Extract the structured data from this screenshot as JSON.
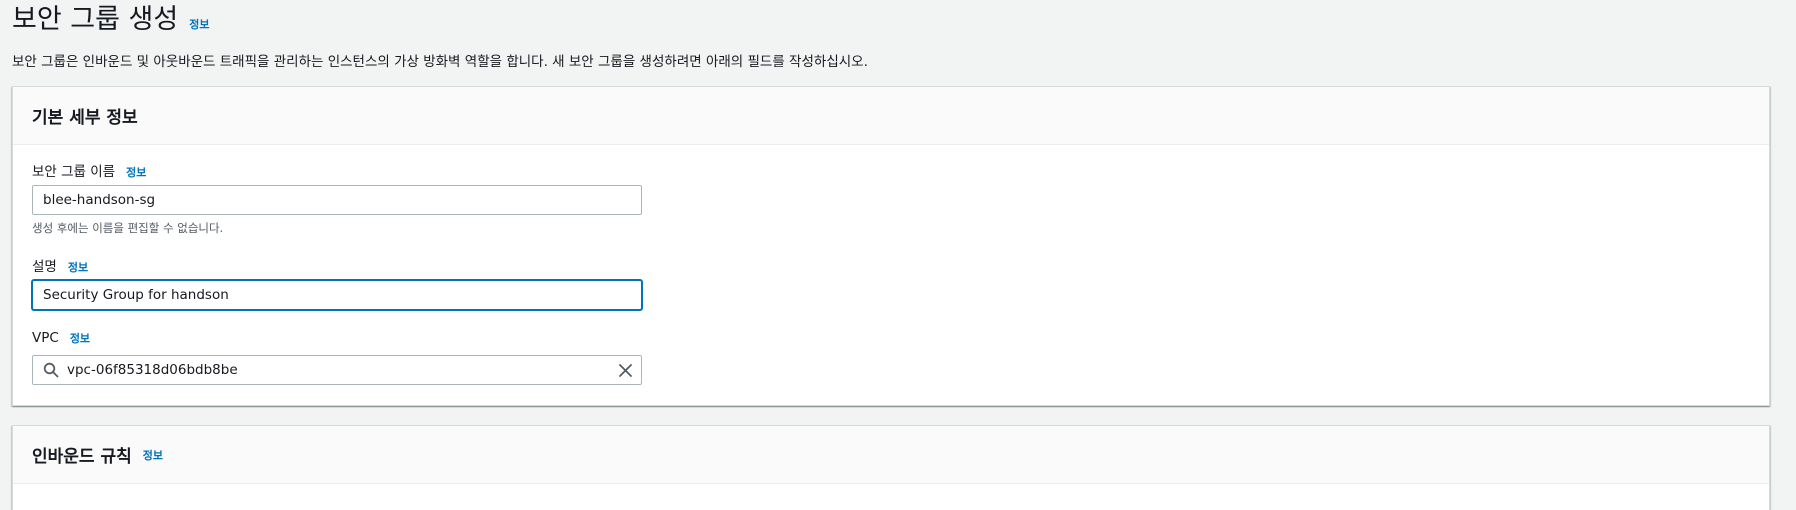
{
  "header": {
    "title": "보안 그룹 생성",
    "info_label": "정보",
    "description": "보안 그룹은 인바운드 및 아웃바운드 트래픽을 관리하는 인스턴스의 가상 방화벽 역할을 합니다. 새 보안 그룹을 생성하려면 아래의 필드를 작성하십시오."
  },
  "basic_details": {
    "title": "기본 세부 정보",
    "name_field": {
      "label": "보안 그룹 이름",
      "info_label": "정보",
      "value": "blee-handson-sg",
      "hint": "생성 후에는 이름을 편집할 수 없습니다."
    },
    "description_field": {
      "label": "설명",
      "info_label": "정보",
      "value": "Security Group for handson"
    },
    "vpc_field": {
      "label": "VPC",
      "info_label": "정보",
      "value": "vpc-06f85318d06bdb8be"
    }
  },
  "inbound_rules": {
    "title": "인바운드 규칙",
    "info_label": "정보"
  },
  "colors": {
    "link": "#0073bb",
    "focus_border": "#0073bb",
    "background": "#f2f3f3"
  },
  "icons": {
    "search": "search-icon",
    "clear": "close-icon"
  }
}
